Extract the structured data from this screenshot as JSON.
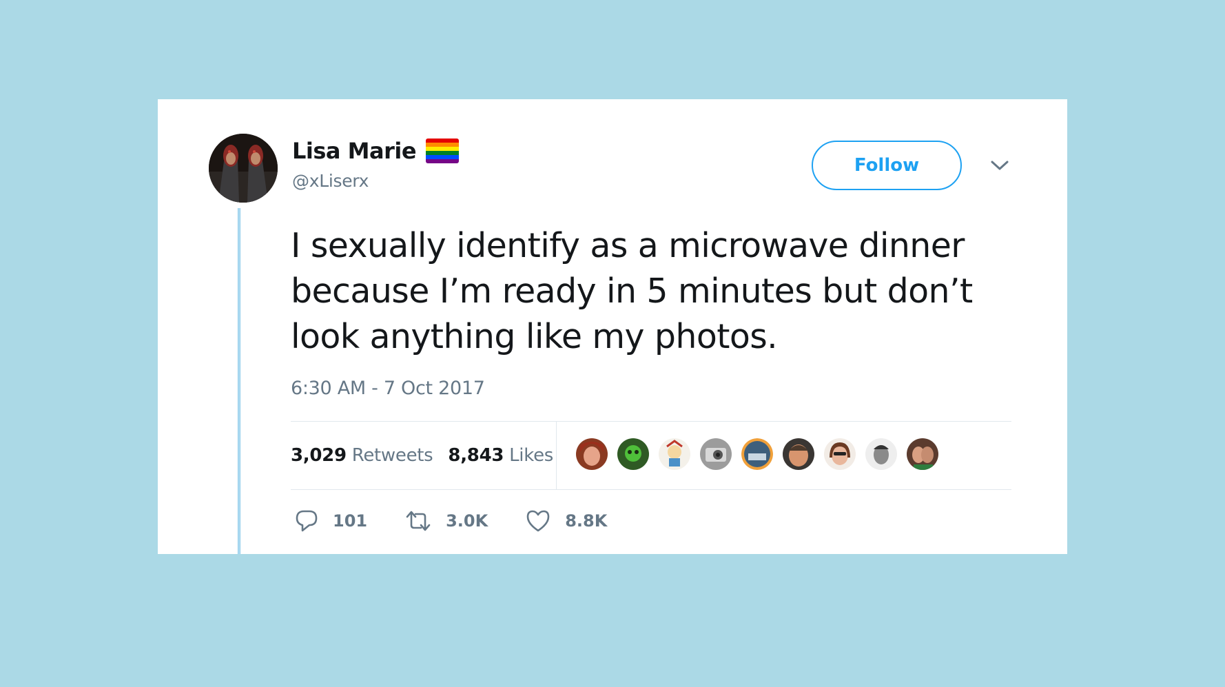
{
  "user": {
    "display_name": "Lisa Marie",
    "handle": "@xLiserx",
    "badge_icon": "rainbow-flag-icon"
  },
  "follow_label": "Follow",
  "tweet": {
    "text": "I sexually identify as a microwave dinner because I’m ready in 5 minutes but don’t look anything like my photos.",
    "timestamp": "6:30 AM - 7 Oct 2017"
  },
  "stats": {
    "retweets_count": "3,029",
    "retweets_label": "Retweets",
    "likes_count": "8,843",
    "likes_label": "Likes"
  },
  "likers": [
    {
      "name": "liker-avatar-1"
    },
    {
      "name": "liker-avatar-2"
    },
    {
      "name": "liker-avatar-3"
    },
    {
      "name": "liker-avatar-4"
    },
    {
      "name": "liker-avatar-5"
    },
    {
      "name": "liker-avatar-6"
    },
    {
      "name": "liker-avatar-7"
    },
    {
      "name": "liker-avatar-8"
    },
    {
      "name": "liker-avatar-9"
    }
  ],
  "actions": {
    "reply_icon": "reply-icon",
    "reply_count": "101",
    "retweet_icon": "retweet-icon",
    "retweet_count": "3.0K",
    "like_icon": "heart-icon",
    "like_count": "8.8K"
  },
  "colors": {
    "background": "#abd9e6",
    "accent": "#1da1f2",
    "muted_text": "#657786",
    "primary_text": "#14171a"
  }
}
